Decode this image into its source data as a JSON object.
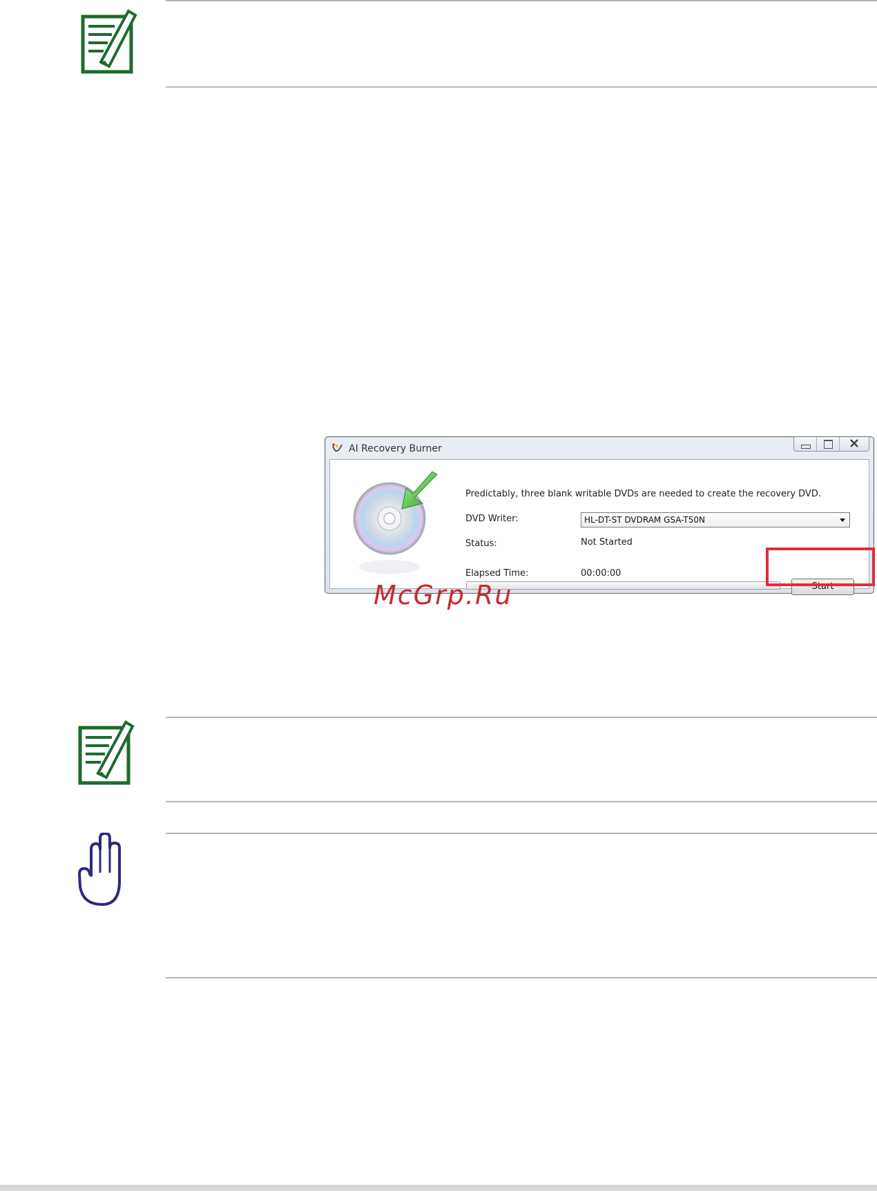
{
  "dialog": {
    "title": "AI Recovery Burner",
    "message": "Predictably, three blank writable DVDs are needed to create the recovery DVD.",
    "dvd_writer_label": "DVD Writer:",
    "dvd_writer_value": "HL-DT-ST DVDRAM GSA-T50N",
    "status_label": "Status:",
    "status_value": "Not Started",
    "elapsed_label": "Elapsed Time:",
    "elapsed_value": "00:00:00",
    "progress_fraction": 0,
    "start_label": "Start"
  },
  "watermark": "McGrp.Ru",
  "colors": {
    "note_icon": "#1d6b2d",
    "warning_icon": "#2c2a7e",
    "highlight": "#e32c3a",
    "watermark": "#c42b2f"
  },
  "icons": [
    "note-icon",
    "note-icon",
    "stop-hand-icon",
    "cd-icon",
    "app-icon"
  ]
}
